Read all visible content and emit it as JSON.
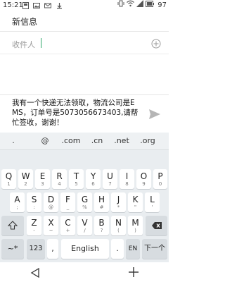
{
  "status_bar": {
    "time": "15:21",
    "battery_level": "97",
    "icons_left": [
      "notification-icon",
      "image-icon",
      "mail-icon",
      "download-icon"
    ],
    "icons_right": [
      "vibrate-icon",
      "wifi-icon",
      "signal-icon",
      "battery-icon"
    ]
  },
  "title_bar": {
    "title": "新信息"
  },
  "recipient": {
    "label": "收件人",
    "add_icon": "plus-circle-icon"
  },
  "message": {
    "text": "我有一个快递无法领取，物流公司是EMS，订单号是5073056673403,请帮忙签收，谢谢！",
    "send_icon": "send-icon"
  },
  "keyboard": {
    "suggestions": [
      ".",
      "@",
      ".com",
      ".cn",
      ".net",
      ".org"
    ],
    "row1": [
      {
        "main": "Q",
        "sub": "1"
      },
      {
        "main": "W",
        "sub": "2"
      },
      {
        "main": "E",
        "sub": "3"
      },
      {
        "main": "R",
        "sub": "4"
      },
      {
        "main": "T",
        "sub": "5"
      },
      {
        "main": "Y",
        "sub": "6"
      },
      {
        "main": "U",
        "sub": "7"
      },
      {
        "main": "I",
        "sub": "8"
      },
      {
        "main": "O",
        "sub": "9"
      },
      {
        "main": "P",
        "sub": "0"
      }
    ],
    "row2": [
      {
        "main": "A",
        "sub": ";"
      },
      {
        "main": "S",
        "sub": ":"
      },
      {
        "main": "D",
        "sub": "@"
      },
      {
        "main": "F",
        "sub": "_"
      },
      {
        "main": "G",
        "sub": "%"
      },
      {
        "main": "H",
        "sub": "#"
      },
      {
        "main": "J",
        "sub": "*"
      },
      {
        "main": "K",
        "sub": "\""
      },
      {
        "main": "L",
        "sub": "'"
      }
    ],
    "row3": [
      {
        "main": "Z",
        "sub": "-"
      },
      {
        "main": "X",
        "sub": "~"
      },
      {
        "main": "C",
        "sub": "+"
      },
      {
        "main": "V",
        "sub": "/"
      },
      {
        "main": "B",
        "sub": "?"
      },
      {
        "main": "N",
        "sub": "("
      },
      {
        "main": "M",
        "sub": ")"
      }
    ],
    "shift_icon": "shift-icon",
    "backspace_icon": "backspace-icon",
    "symbols_label": "~*",
    "numbers_label": "123",
    "comma_label": ",",
    "space_label": "English",
    "period_label": ".",
    "lang_label": "EN",
    "enter_label": "下一个"
  },
  "nav_bar": {
    "back_icon": "back-triangle-icon",
    "plus_icon": "plus-icon"
  }
}
